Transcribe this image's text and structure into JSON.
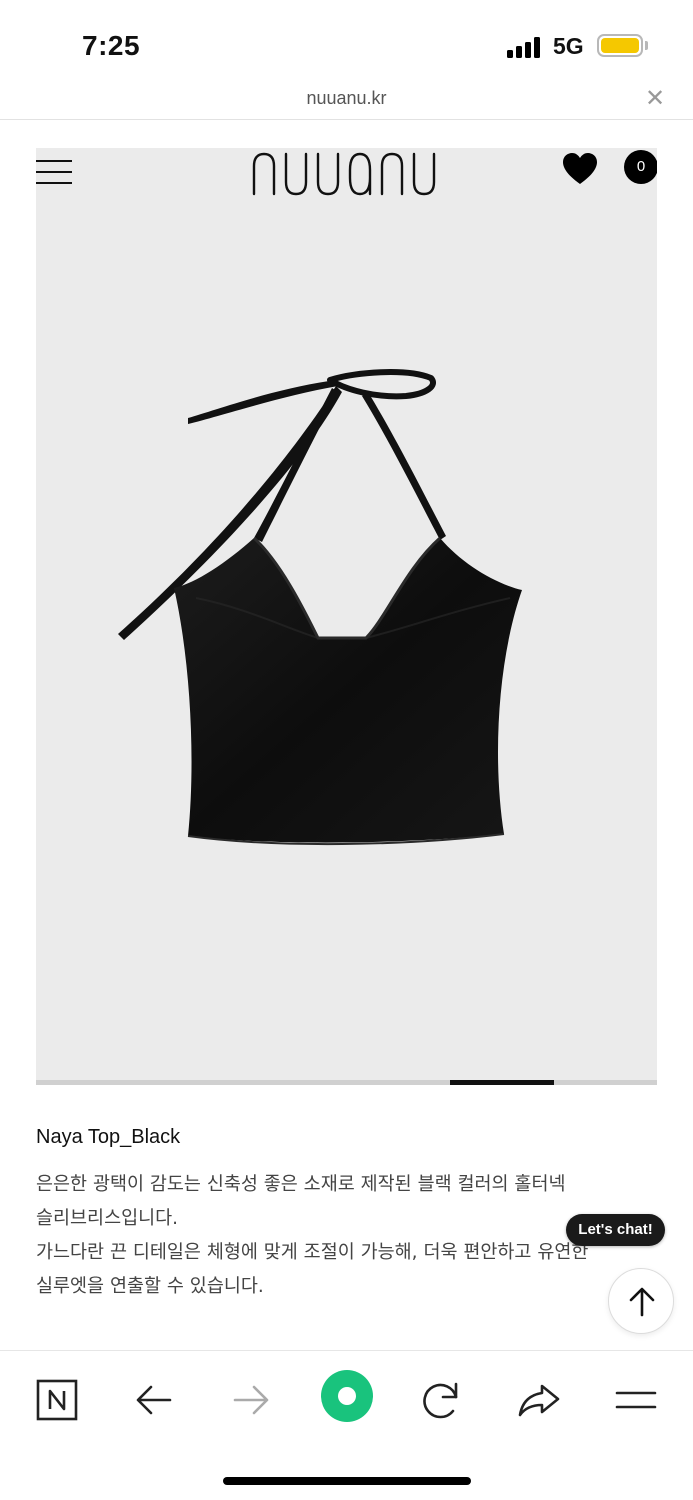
{
  "status_bar": {
    "time": "7:25",
    "network": "5G",
    "battery_color": "#f5c800"
  },
  "browser": {
    "url": "nuuanu.kr",
    "close_icon": "close-icon"
  },
  "header": {
    "brand": "nuuanu",
    "cart_count": "0",
    "menu_icon": "hamburger-menu-icon",
    "wishlist_icon": "heart-icon"
  },
  "gallery": {
    "slide_progress": "active segment between 0.667 and 0.833 of the track"
  },
  "product": {
    "name": "Naya Top_Black",
    "description_lines": [
      "은은한 광택이 감도는 신축성 좋은 소재로 제작된 블랙 컬러의 홀터넥",
      "슬리브리스입니다.",
      "가느다란 끈 디테일은 체형에 맞게 조절이 가능해, 더욱 편안하고 유연한",
      "실루엣을 연출할 수 있습니다."
    ]
  },
  "floating": {
    "chat_label": "Let's chat!",
    "scroll_top_icon": "arrow-up-icon"
  },
  "toolbar": {
    "items": [
      "naver-home-icon",
      "back-arrow-icon",
      "forward-arrow-icon",
      "green-dot-button",
      "refresh-icon",
      "share-icon",
      "menu-icon"
    ],
    "accent_color": "#19c37d"
  }
}
